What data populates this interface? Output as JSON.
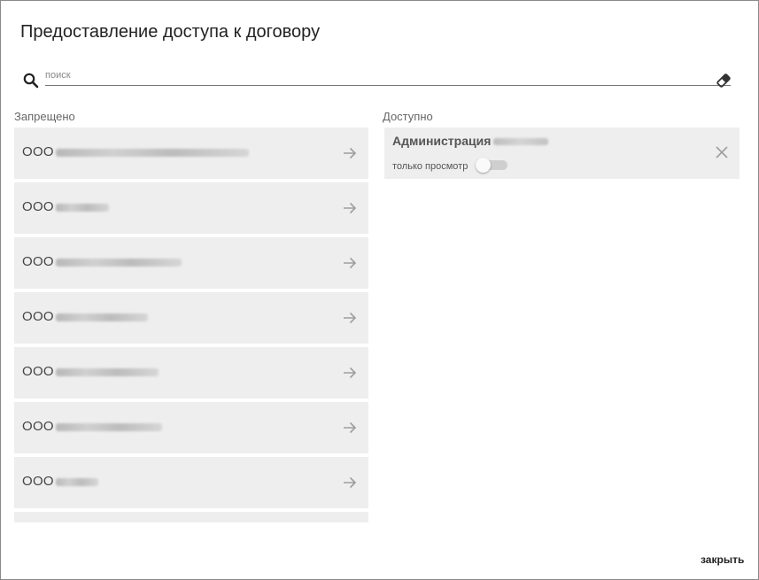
{
  "dialog": {
    "title": "Предоставление доступа к договору",
    "close_label": "закрыть"
  },
  "search": {
    "placeholder": "поиск",
    "search_icon": "search-icon",
    "clear_icon": "eraser-icon"
  },
  "forbidden": {
    "label": "Запрещено",
    "items": [
      {
        "prefix": "ООО"
      },
      {
        "prefix": "ООО"
      },
      {
        "prefix": "ООО"
      },
      {
        "prefix": "ООО"
      },
      {
        "prefix": "ООО"
      },
      {
        "prefix": "ООО"
      },
      {
        "prefix": "ООО"
      }
    ],
    "item_icon": "arrow-right-icon"
  },
  "allowed": {
    "label": "Доступно",
    "items": [
      {
        "name": "Администрация",
        "permission_label": "только просмотр",
        "view_only": false
      }
    ],
    "remove_icon": "close-icon"
  },
  "colors": {
    "row_bg": "#eeeeee",
    "border": "#8a8a8a"
  }
}
